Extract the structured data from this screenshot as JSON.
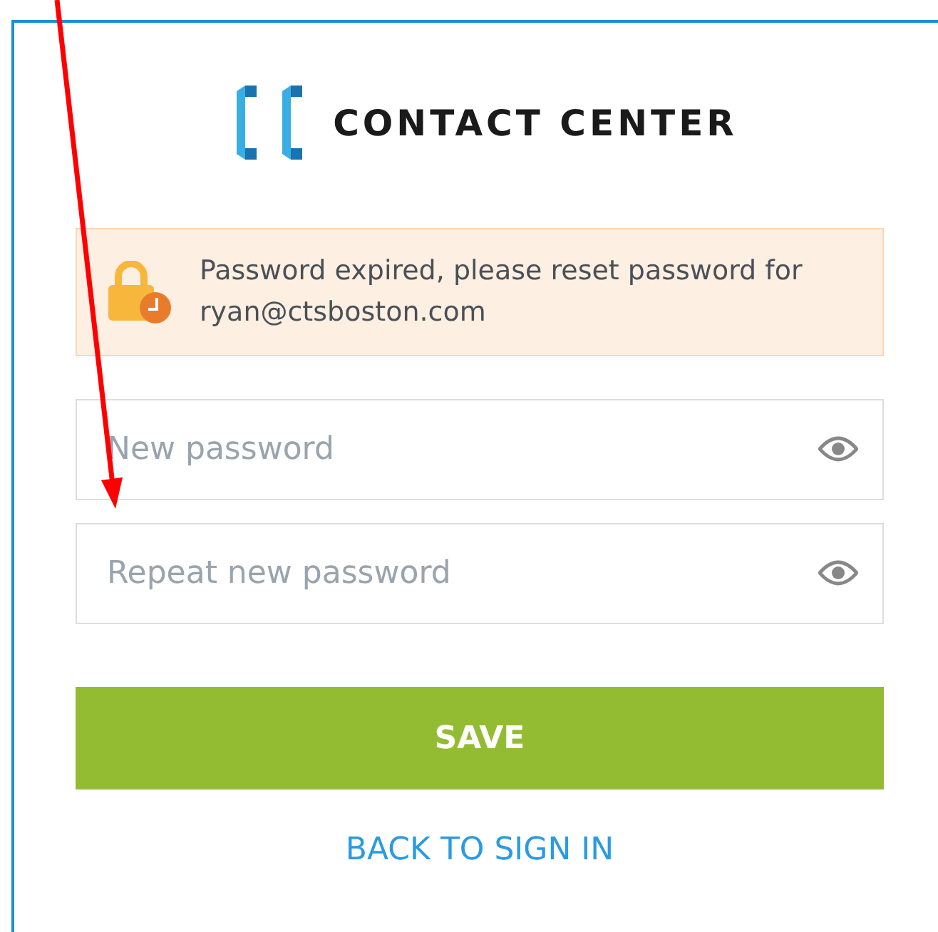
{
  "logo": {
    "text": "CONTACT CENTER"
  },
  "alert": {
    "message": "Password expired, please reset password for ryan@ctsboston.com"
  },
  "fields": [
    {
      "placeholder": "New password"
    },
    {
      "placeholder": "Repeat new password"
    }
  ],
  "save_button": "SAVE",
  "back_link": "BACK TO SIGN IN"
}
